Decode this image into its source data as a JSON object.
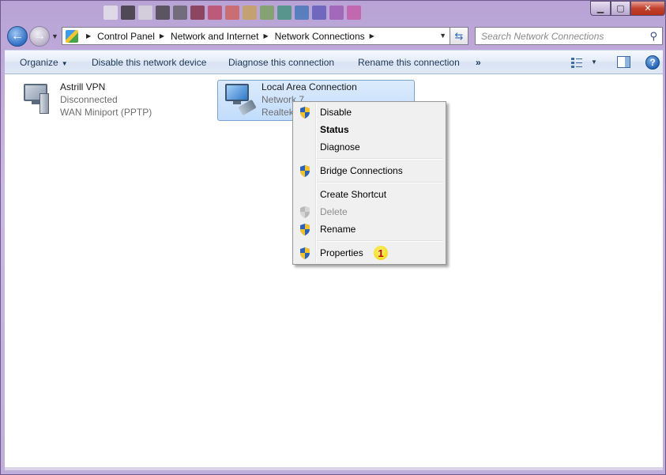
{
  "window": {
    "controls": {
      "minimize": "▁",
      "maximize": "▢",
      "close": "✕"
    }
  },
  "nav": {
    "back_icon": "arrow-left-icon",
    "forward_icon": "arrow-right-icon",
    "breadcrumbs": [
      "Control Panel",
      "Network and Internet",
      "Network Connections"
    ]
  },
  "search": {
    "placeholder": "Search Network Connections"
  },
  "toolbar": {
    "organize": "Organize",
    "disable": "Disable this network device",
    "diagnose": "Diagnose this connection",
    "rename": "Rename this connection",
    "more": "»",
    "help": "?"
  },
  "connections": [
    {
      "name": "Astrill VPN",
      "status": "Disconnected",
      "device": "WAN Miniport (PPTP)"
    },
    {
      "name": "Local Area Connection",
      "status": "Network  7",
      "device": "Realtek"
    }
  ],
  "context_menu": {
    "items": [
      {
        "label": "Disable",
        "shield": true
      },
      {
        "label": "Status",
        "bold": true
      },
      {
        "label": "Diagnose"
      },
      {
        "label": "Bridge Connections",
        "shield": true
      },
      {
        "label": "Create Shortcut"
      },
      {
        "label": "Delete",
        "shield": true,
        "disabled": true
      },
      {
        "label": "Rename",
        "shield": true
      },
      {
        "label": "Properties",
        "shield": true,
        "badge": "1"
      }
    ]
  },
  "colors": {
    "accent": "#2f6fc4",
    "selection": "#c1dcfc",
    "badge": "#f3dd1d"
  }
}
